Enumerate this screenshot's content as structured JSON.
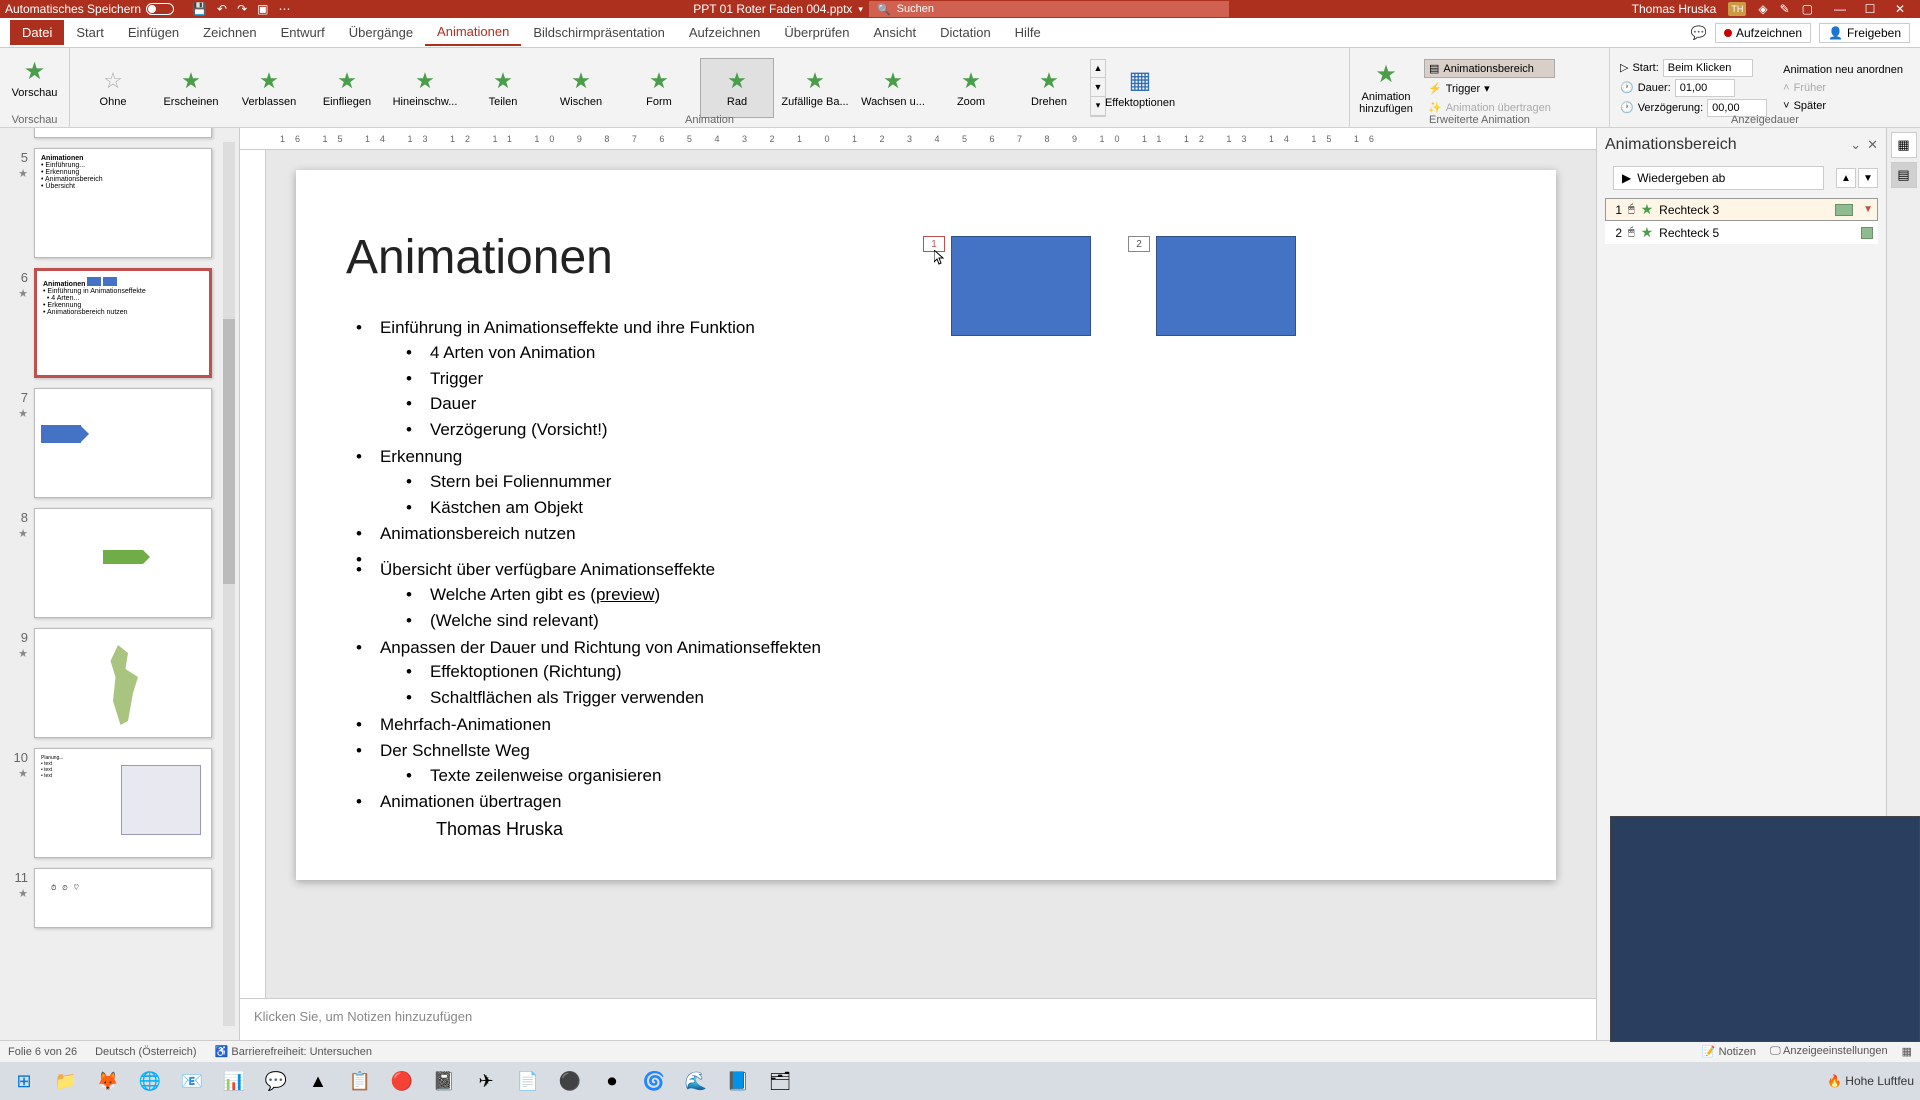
{
  "titlebar": {
    "autosave": "Automatisches Speichern",
    "filename": "PPT 01 Roter Faden 004.pptx",
    "search_placeholder": "Suchen",
    "user": "Thomas Hruska",
    "user_initials": "TH"
  },
  "tabs": {
    "file": "Datei",
    "start": "Start",
    "insert": "Einfügen",
    "draw": "Zeichnen",
    "design": "Entwurf",
    "transitions": "Übergänge",
    "animations": "Animationen",
    "slideshow": "Bildschirmpräsentation",
    "record": "Aufzeichnen",
    "review": "Überprüfen",
    "view": "Ansicht",
    "dictation": "Dictation",
    "help": "Hilfe",
    "record_btn": "Aufzeichnen",
    "share_btn": "Freigeben"
  },
  "ribbon": {
    "preview": "Vorschau",
    "animation_group": "Animation",
    "items": {
      "none": "Ohne",
      "appear": "Erscheinen",
      "fade": "Verblassen",
      "flyin": "Einfliegen",
      "floatin": "Hineinschw...",
      "split": "Teilen",
      "wipe": "Wischen",
      "shape": "Form",
      "wheel": "Rad",
      "random": "Zufällige Ba...",
      "grow": "Wachsen u...",
      "zoom": "Zoom",
      "swivel": "Drehen"
    },
    "effect_options": "Effektoptionen",
    "advanced_group": "Erweiterte Animation",
    "add_animation": "Animation hinzufügen",
    "animation_pane": "Animationsbereich",
    "trigger": "Trigger",
    "painter": "Animation übertragen",
    "timing_group": "Anzeigedauer",
    "start_label": "Start:",
    "start_value": "Beim Klicken",
    "duration_label": "Dauer:",
    "duration_value": "01,00",
    "delay_label": "Verzögerung:",
    "delay_value": "00,00",
    "reorder": "Animation neu anordnen",
    "earlier": "Früher",
    "later": "Später"
  },
  "thumbs": {
    "n5": "5",
    "n6": "6",
    "n7": "7",
    "n8": "8",
    "n9": "9",
    "n10": "10",
    "n11": "11"
  },
  "slide": {
    "title": "Animationen",
    "b1": "Einführung in Animationseffekte und ihre Funktion",
    "b1_1": "4 Arten von Animation",
    "b1_2": "Trigger",
    "b1_3": "Dauer",
    "b1_4": "Verzögerung (Vorsicht!)",
    "b2": "Erkennung",
    "b2_1": "Stern bei Foliennummer",
    "b2_2": "Kästchen am Objekt",
    "b3": "Animationsbereich nutzen",
    "b4": "Übersicht über verfügbare Animationseffekte",
    "b4_1a": "Welche Arten gibt es (",
    "b4_1b": "preview",
    "b4_1c": ")",
    "b4_2": "(Welche sind relevant)",
    "b5": "Anpassen der Dauer und Richtung von Animationseffekten",
    "b5_1": "Effektoptionen (Richtung)",
    "b5_2": "Schaltflächen als Trigger verwenden",
    "b6": "Mehrfach-Animationen",
    "b7": "Der Schnellste Weg",
    "b7_1": "Texte zeilenweise organisieren",
    "b8": "Animationen übertragen",
    "author": "Thomas Hruska",
    "tag1": "1",
    "tag2": "2"
  },
  "notes_placeholder": "Klicken Sie, um Notizen hinzuzufügen",
  "anim_pane": {
    "title": "Animationsbereich",
    "play": "Wiedergeben ab",
    "items": [
      {
        "idx": "1",
        "name": "Rechteck 3"
      },
      {
        "idx": "2",
        "name": "Rechteck 5"
      }
    ]
  },
  "statusbar": {
    "slide_pos": "Folie 6 von 26",
    "language": "Deutsch (Österreich)",
    "accessibility": "Barrierefreiheit: Untersuchen",
    "notes_btn": "Notizen",
    "display_btn": "Anzeigeeinstellungen"
  },
  "taskbar": {
    "weather": "Hohe Luftfeu"
  }
}
